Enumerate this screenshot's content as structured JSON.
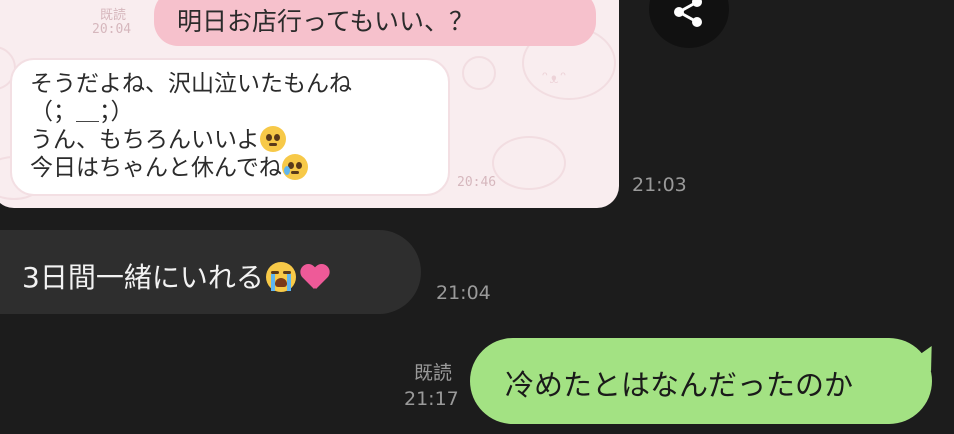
{
  "image_message": {
    "inner_read_label": "既読",
    "inner_read_time": "20:04",
    "inner_sent_text": "明日お店行ってもいい、？",
    "inner_reply_lines": [
      "そうだよね、沢山泣いたもんね",
      "（；＿；）",
      "うん、もちろんいいよ",
      "今日はちゃんと休んでね"
    ],
    "inner_reply_time": "20:46",
    "time": "21:03"
  },
  "received_message": {
    "text": "3日間一緒にいれる",
    "emojis": [
      "crying-emoji",
      "sparkling-heart-emoji"
    ],
    "time": "21:04"
  },
  "sent_message": {
    "read_label": "既読",
    "time": "21:17",
    "text": "冷めたとはなんだったのか",
    "bubble_color": "#a3e283"
  },
  "share_button": {
    "icon": "share-icon"
  }
}
